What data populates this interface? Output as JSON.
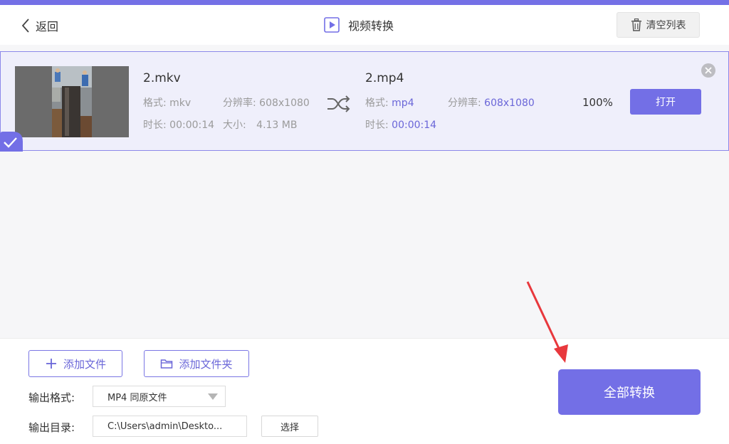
{
  "header": {
    "back_label": "返回",
    "title": "视频转换",
    "clear_label": "清空列表"
  },
  "file": {
    "source": {
      "name": "2.mkv",
      "format_label": "格式:",
      "format": "mkv",
      "resolution_label": "分辨率:",
      "resolution": "608x1080",
      "duration_label": "时长:",
      "duration": "00:00:14",
      "size_label": "大小:",
      "size": "4.13 MB"
    },
    "output": {
      "name": "2.mp4",
      "format_label": "格式:",
      "format": "mp4",
      "resolution_label": "分辨率:",
      "resolution": "608x1080",
      "duration_label": "时长:",
      "duration": "00:00:14"
    },
    "progress": "100%",
    "open_label": "打开"
  },
  "footer": {
    "add_file_label": "添加文件",
    "add_folder_label": "添加文件夹",
    "output_format_label": "输出格式:",
    "output_format_value": "MP4 同原文件",
    "output_dir_label": "输出目录:",
    "output_dir_value": "C:\\Users\\admin\\Deskto...",
    "choose_label": "选择",
    "convert_all_label": "全部转换"
  },
  "colors": {
    "accent": "#736fe6",
    "card_bg": "#efeffb",
    "arrow": "#e8383d"
  }
}
